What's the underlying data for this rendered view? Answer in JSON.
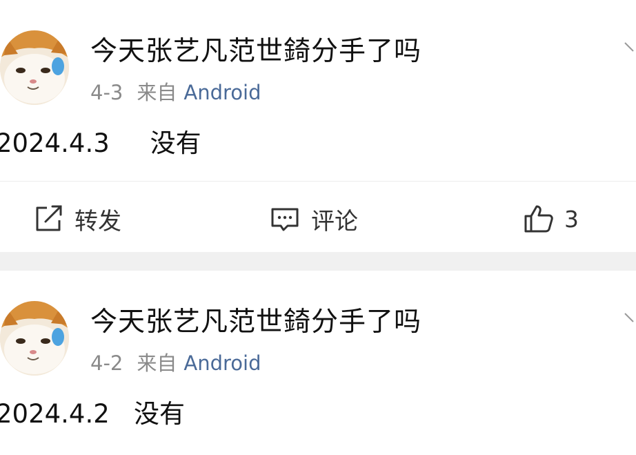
{
  "posts": [
    {
      "author": "今天张艺凡范世錡分手了吗",
      "date": "4-3",
      "source_label": "来自",
      "device": "Android",
      "content": "2024.4.3     没有",
      "actions": {
        "repost_label": "转发",
        "comment_label": "评论",
        "like_count": "3"
      }
    },
    {
      "author": "今天张艺凡范世錡分手了吗",
      "date": "4-2",
      "source_label": "来自",
      "device": "Android",
      "content": "2024.4.2   没有"
    }
  ],
  "colors": {
    "text_primary": "#111111",
    "text_meta": "#8a8a8a",
    "device_link": "#4a6a98",
    "separator": "#f0f0f0"
  },
  "icons": {
    "avatar": "cat-avatar",
    "more": "chevron-down-icon",
    "repost": "repost-icon",
    "comment": "comment-icon",
    "like": "thumbs-up-icon"
  }
}
